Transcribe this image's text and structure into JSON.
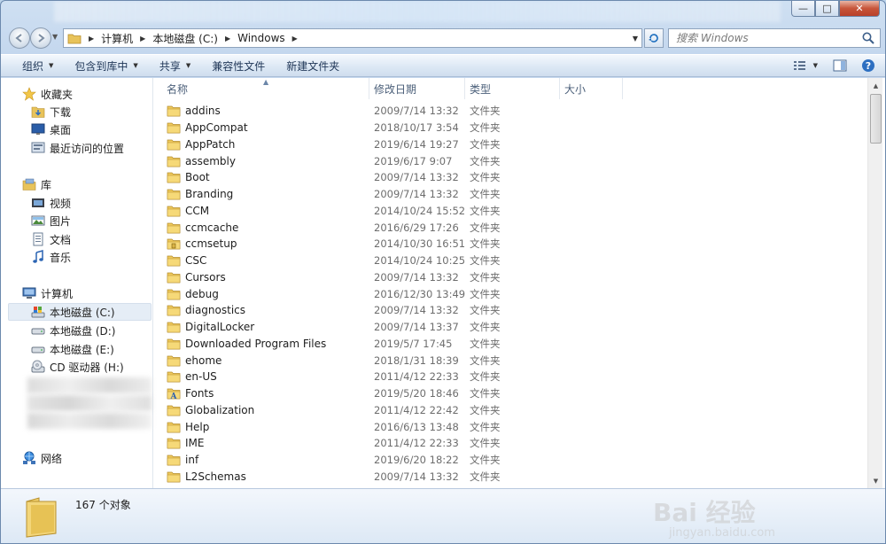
{
  "window": {
    "controls": {
      "minimize": "—",
      "maximize": "□",
      "close": "✕"
    }
  },
  "address": {
    "crumbs": [
      "计算机",
      "本地磁盘 (C:)",
      "Windows"
    ],
    "search_placeholder": "搜索 Windows"
  },
  "toolbar": {
    "organize": "组织",
    "include_in_library": "包含到库中",
    "share": "共享",
    "compatibility_files": "兼容性文件",
    "new_folder": "新建文件夹"
  },
  "nav": {
    "favorites": {
      "label": "收藏夹",
      "items": [
        "下载",
        "桌面",
        "最近访问的位置"
      ]
    },
    "libraries": {
      "label": "库",
      "items": [
        "视频",
        "图片",
        "文档",
        "音乐"
      ]
    },
    "computer": {
      "label": "计算机",
      "items": [
        "本地磁盘 (C:)",
        "本地磁盘 (D:)",
        "本地磁盘 (E:)",
        "CD 驱动器 (H:)"
      ]
    },
    "network": {
      "label": "网络"
    }
  },
  "columns": {
    "name": "名称",
    "modified": "修改日期",
    "type": "类型",
    "size": "大小"
  },
  "files": [
    {
      "name": "addins",
      "modified": "2009/7/14 13:32",
      "type": "文件夹"
    },
    {
      "name": "AppCompat",
      "modified": "2018/10/17 3:54",
      "type": "文件夹"
    },
    {
      "name": "AppPatch",
      "modified": "2019/6/14 19:27",
      "type": "文件夹"
    },
    {
      "name": "assembly",
      "modified": "2019/6/17 9:07",
      "type": "文件夹"
    },
    {
      "name": "Boot",
      "modified": "2009/7/14 13:32",
      "type": "文件夹"
    },
    {
      "name": "Branding",
      "modified": "2009/7/14 13:32",
      "type": "文件夹"
    },
    {
      "name": "CCM",
      "modified": "2014/10/24 15:52",
      "type": "文件夹"
    },
    {
      "name": "ccmcache",
      "modified": "2016/6/29 17:26",
      "type": "文件夹"
    },
    {
      "name": "ccmsetup",
      "modified": "2014/10/30 16:51",
      "type": "文件夹"
    },
    {
      "name": "CSC",
      "modified": "2014/10/24 10:25",
      "type": "文件夹"
    },
    {
      "name": "Cursors",
      "modified": "2009/7/14 13:32",
      "type": "文件夹"
    },
    {
      "name": "debug",
      "modified": "2016/12/30 13:49",
      "type": "文件夹"
    },
    {
      "name": "diagnostics",
      "modified": "2009/7/14 13:32",
      "type": "文件夹"
    },
    {
      "name": "DigitalLocker",
      "modified": "2009/7/14 13:37",
      "type": "文件夹"
    },
    {
      "name": "Downloaded Program Files",
      "modified": "2019/5/7 17:45",
      "type": "文件夹"
    },
    {
      "name": "ehome",
      "modified": "2018/1/31 18:39",
      "type": "文件夹"
    },
    {
      "name": "en-US",
      "modified": "2011/4/12 22:33",
      "type": "文件夹"
    },
    {
      "name": "Fonts",
      "modified": "2019/5/20 18:46",
      "type": "文件夹"
    },
    {
      "name": "Globalization",
      "modified": "2011/4/12 22:42",
      "type": "文件夹"
    },
    {
      "name": "Help",
      "modified": "2016/6/13 13:48",
      "type": "文件夹"
    },
    {
      "name": "IME",
      "modified": "2011/4/12 22:33",
      "type": "文件夹"
    },
    {
      "name": "inf",
      "modified": "2019/6/20 18:22",
      "type": "文件夹"
    },
    {
      "name": "L2Schemas",
      "modified": "2009/7/14 13:32",
      "type": "文件夹"
    }
  ],
  "details": {
    "count": "167 个对象"
  },
  "watermark": {
    "text": "Bai 经验",
    "url": "jingyan.baidu.com"
  }
}
